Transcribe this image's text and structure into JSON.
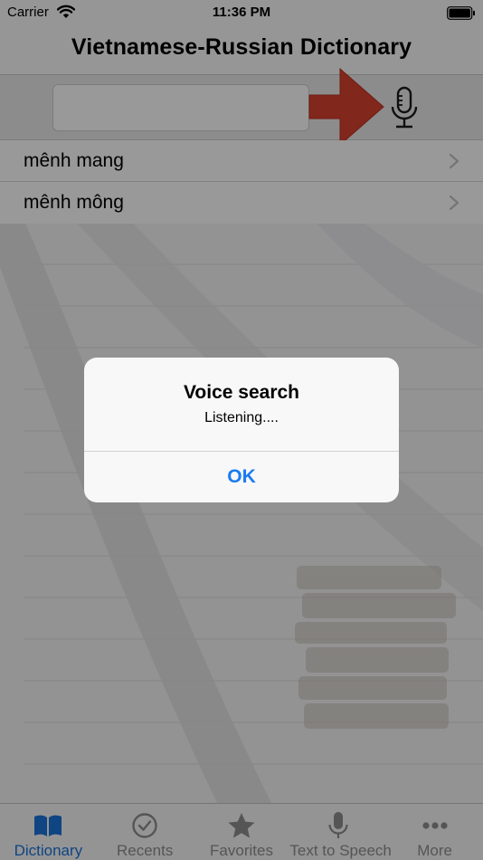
{
  "status_bar": {
    "carrier": "Carrier",
    "time": "11:36 PM"
  },
  "nav": {
    "title": "Vietnamese-Russian Dictionary"
  },
  "search": {
    "value": "",
    "placeholder": ""
  },
  "words": [
    {
      "label": "mênh mang"
    },
    {
      "label": "mênh mông"
    }
  ],
  "tabs": [
    {
      "label": "Dictionary",
      "icon": "book-icon",
      "active": true
    },
    {
      "label": "Recents",
      "icon": "clock-icon",
      "active": false
    },
    {
      "label": "Favorites",
      "icon": "star-icon",
      "active": false
    },
    {
      "label": "Text to Speech",
      "icon": "microphone-icon",
      "active": false
    },
    {
      "label": "More",
      "icon": "more-dots-icon",
      "active": false
    }
  ],
  "alert": {
    "title": "Voice search",
    "message": "Listening....",
    "ok_label": "OK"
  },
  "colors": {
    "accent": "#1a7cf1",
    "tab_active": "#1a73d9",
    "arrow": "#d9412e"
  }
}
